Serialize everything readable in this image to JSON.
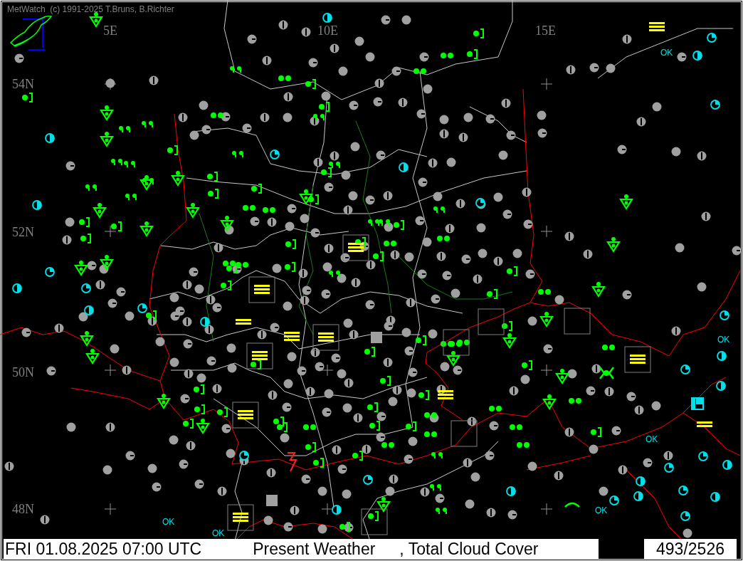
{
  "title": "MetWatch  (c) 1991-2025 T.Bruns, B.Richter",
  "longitude_labels": [
    "5E",
    "10E",
    "15E"
  ],
  "latitude_labels": [
    "54N",
    "52N",
    "50N",
    "48N"
  ],
  "map_labels": [
    "OK",
    "OK",
    "OK",
    "OK",
    "OK",
    "OK"
  ],
  "status_bar": {
    "datetime": "FRI 01.08.2025 07:00 UTC",
    "parameter": "Present Weather",
    "parameter_2": ", Total Cloud Cover",
    "count": "493/2526"
  }
}
